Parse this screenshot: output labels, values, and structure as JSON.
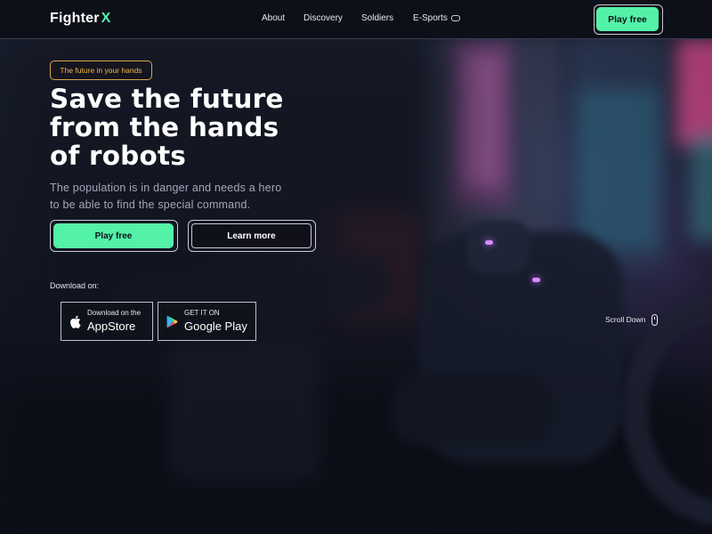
{
  "header": {
    "logo_text": "Fighter",
    "logo_accent": "X",
    "nav": [
      {
        "label": "About"
      },
      {
        "label": "Discovery"
      },
      {
        "label": "Soldiers"
      },
      {
        "label": "E-Sports",
        "icon": "gamepad-icon"
      }
    ],
    "cta_label": "Play free"
  },
  "hero": {
    "badge": "The future in your hands",
    "headline_lines": [
      "Save the future",
      "from the hands",
      "of robots"
    ],
    "subtext_lines": [
      "The population is in danger and needs a hero",
      "to be able to find the special command."
    ],
    "primary_cta": "Play free",
    "secondary_cta": "Learn more"
  },
  "download": {
    "label": "Download on:",
    "stores": [
      {
        "small": "Download on the",
        "big": "AppStore",
        "icon": "apple-icon"
      },
      {
        "small": "GET IT ON",
        "big": "Google Play",
        "icon": "google-play-icon"
      }
    ]
  },
  "scroll": {
    "label": "Scroll Down",
    "icon": "mouse-icon"
  },
  "colors": {
    "accent": "#54f2a8",
    "badge": "#f1b94c",
    "background": "#0d1019"
  }
}
